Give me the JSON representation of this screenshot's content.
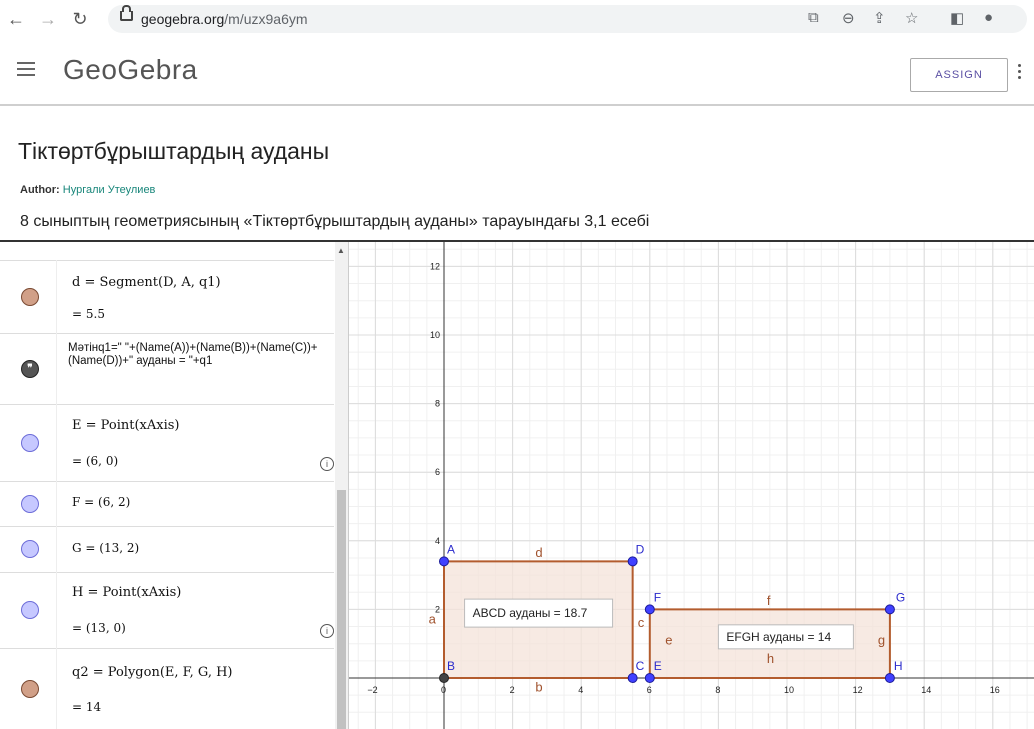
{
  "browser": {
    "url_host": "geogebra.org",
    "url_path": "/m/uzx9a6ym"
  },
  "app": {
    "logo": "GeoGebra",
    "assign_label": "ASSIGN"
  },
  "page": {
    "title": "Тіктөртбұрыштардың ауданы",
    "author_label": "Author:",
    "author_name": "Нургали Утеулиев",
    "description": "8 сыныптың геометриясының «Тіктөртбұрыштардың ауданы» тарауындағы 3,1 есебі"
  },
  "algebra": {
    "rows": [
      {
        "def": "d = Segment(D, A, q1)",
        "val": "= 5.5",
        "marble": "brown"
      },
      {
        "def": "Мәтінq1=\" \"+(Name(A))+(Name(B))+(Name(C))+(Name(D))+\" ауданы = \"+q1",
        "val": "",
        "marble": "quote"
      },
      {
        "def": "E = Point(xAxis)",
        "val": "= (6, 0)",
        "marble": "blue"
      },
      {
        "def": "F = (6, 2)",
        "val": "",
        "marble": "blue"
      },
      {
        "def": "G = (13, 2)",
        "val": "",
        "marble": "blue"
      },
      {
        "def": "H = Point(xAxis)",
        "val": "= (13, 0)",
        "marble": "blue"
      },
      {
        "def": "q2 = Polygon(E, F, G, H)",
        "val": "= 14",
        "marble": "brown"
      }
    ]
  },
  "graph": {
    "x_ticks": [
      "−2",
      "0",
      "2",
      "4",
      "6",
      "8",
      "10",
      "12",
      "14",
      "16"
    ],
    "y_ticks": [
      "2",
      "4",
      "6",
      "8",
      "10",
      "12"
    ],
    "points": {
      "A": "A",
      "B": "B",
      "C": "C",
      "D": "D",
      "E": "E",
      "F": "F",
      "G": "G",
      "H": "H"
    },
    "segment_labels": {
      "a": "a",
      "b": "b",
      "c": "c",
      "d": "d",
      "e": "e",
      "f": "f",
      "g": "g",
      "h": "h"
    },
    "text1": "ABCD ауданы = 18.7",
    "text2": "EFGH ауданы = 14",
    "colors": {
      "polygon_stroke": "#b35c2e",
      "polygon_fill": "#f4e3da",
      "point": "#4040ff"
    }
  }
}
